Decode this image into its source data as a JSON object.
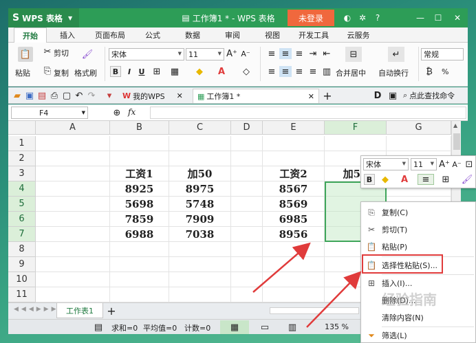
{
  "titlebar": {
    "app_name": "WPS 表格",
    "window_title": "工作簿1 * - WPS 表格",
    "login": "未登录"
  },
  "menu": {
    "tabs": [
      "开始",
      "插入",
      "页面布局",
      "公式",
      "数据",
      "审阅",
      "视图",
      "开发工具",
      "云服务"
    ]
  },
  "ribbon": {
    "paste": "粘贴",
    "cut": "剪切",
    "copy": "复制",
    "format_painter": "格式刷",
    "font_name": "宋体",
    "font_size": "11",
    "bold": "B",
    "italic": "I",
    "underline": "U",
    "merge_center": "合并居中",
    "wrap_text": "自动换行",
    "number_format": "常规",
    "percent": "%"
  },
  "docbar": {
    "my_wps": "我的WPS",
    "workbook_tab": "工作簿1 *",
    "add_tab": "+",
    "search": "点此查找命令"
  },
  "formula_bar": {
    "name_box": "F4",
    "fx": "fx"
  },
  "grid": {
    "columns": [
      "A",
      "B",
      "C",
      "D",
      "E",
      "F",
      "G"
    ],
    "rows": [
      "1",
      "2",
      "3",
      "4",
      "5",
      "6",
      "7",
      "8",
      "9",
      "10",
      "11"
    ],
    "cells": {
      "B3": "工资1",
      "C3": "加50",
      "E3": "工资2",
      "F3": "加50",
      "B4": "8925",
      "C4": "8975",
      "E4": "8567",
      "B5": "5698",
      "C5": "5748",
      "E5": "8569",
      "B6": "7859",
      "C6": "7909",
      "E6": "6985",
      "B7": "6988",
      "C7": "7038",
      "E7": "8956"
    }
  },
  "sheet_tabs": {
    "sheet1": "工作表1",
    "add": "+"
  },
  "status": {
    "sum": "求和=0",
    "average": "平均值=0",
    "count": "计数=0",
    "zoom": "135 %"
  },
  "mini_toolbar": {
    "font_name": "宋体",
    "font_size": "11",
    "bold": "B"
  },
  "context_menu": {
    "items": [
      {
        "label": "复制(C)",
        "icon": "copy-icon"
      },
      {
        "label": "剪切(T)",
        "icon": "scissors-icon"
      },
      {
        "label": "粘贴(P)",
        "icon": "paste-icon"
      },
      {
        "label": "选择性粘贴(S)...",
        "icon": "paste-special-icon"
      },
      {
        "label": "插入(I)...",
        "icon": "insert-icon"
      },
      {
        "label": "删除(D)...",
        "icon": "delete-icon"
      },
      {
        "label": "清除内容(N)",
        "icon": "clear-icon"
      },
      {
        "label": "筛选(L)",
        "icon": "filter-icon"
      }
    ]
  },
  "watermark": "经验指南",
  "colors": {
    "title_green": "#2d9d57",
    "login_orange": "#f0683d",
    "selection_green": "#3ea65a",
    "highlight_red": "#e03b3b"
  }
}
